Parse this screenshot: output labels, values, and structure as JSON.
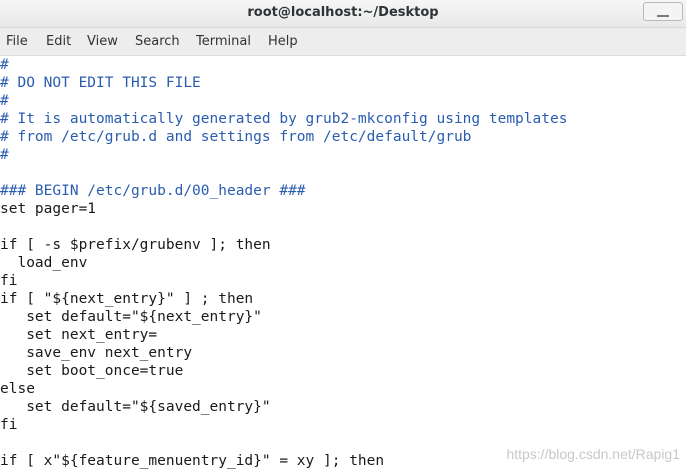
{
  "window": {
    "title": "root@localhost:~/Desktop"
  },
  "menu": [
    "File",
    "Edit",
    "View",
    "Search",
    "Terminal",
    "Help"
  ],
  "terminal": {
    "lines": [
      "#",
      "# DO NOT EDIT THIS FILE",
      "#",
      "# It is automatically generated by grub2-mkconfig using templates",
      "# from /etc/grub.d and settings from /etc/default/grub",
      "#",
      "",
      "### BEGIN /etc/grub.d/00_header ###",
      "set pager=1",
      "",
      "if [ -s $prefix/grubenv ]; then",
      "  load_env",
      "fi",
      "if [ \"${next_entry}\" ] ; then",
      "   set default=\"${next_entry}\"",
      "   set next_entry=",
      "   save_env next_entry",
      "   set boot_once=true",
      "else",
      "   set default=\"${saved_entry}\"",
      "fi",
      "",
      "if [ x\"${feature_menuentry_id}\" = xy ]; then"
    ]
  },
  "watermark": "https://blog.csdn.net/Rapig1"
}
